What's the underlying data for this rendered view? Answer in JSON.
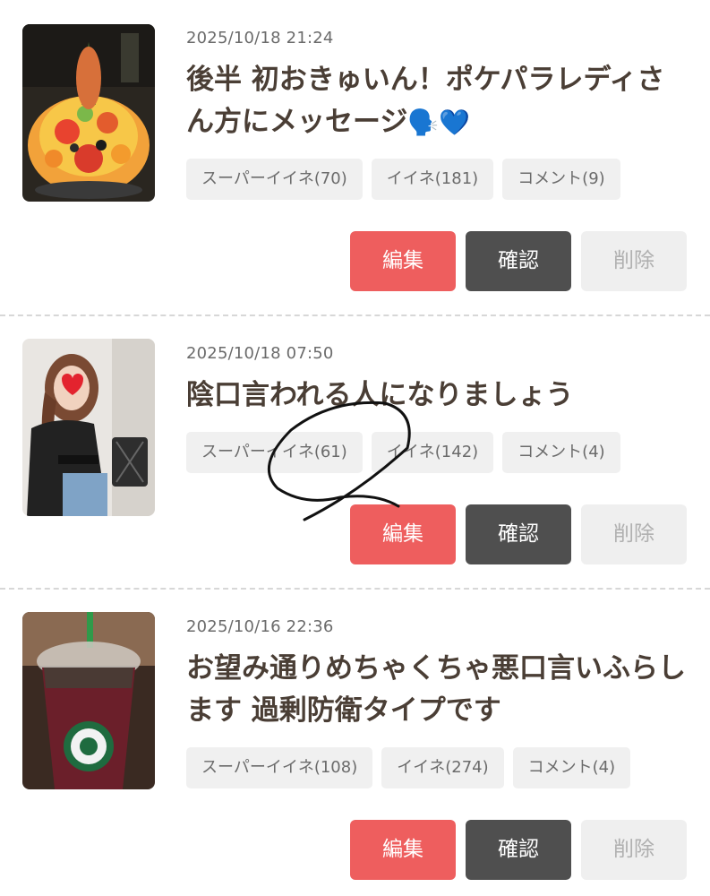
{
  "posts": [
    {
      "date": "2025/10/18 21:24",
      "title": "後半 初おきゅいん！ポケパラレディさん方にメッセージ",
      "title_emoji": "🗣️💙",
      "thumbnail_icon": "fruit-platter-photo",
      "tags": [
        "スーパーイイネ(70)",
        "イイネ(181)",
        "コメント(9)"
      ],
      "actions": {
        "edit": "編集",
        "confirm": "確認",
        "delete": "削除"
      }
    },
    {
      "date": "2025/10/18 07:50",
      "title": "陰口言われる人になりましょう",
      "title_emoji": "",
      "thumbnail_icon": "woman-selfie-photo",
      "tags": [
        "スーパーイイネ(61)",
        "イイネ(142)",
        "コメント(4)"
      ],
      "actions": {
        "edit": "編集",
        "confirm": "確認",
        "delete": "削除"
      }
    },
    {
      "date": "2025/10/16 22:36",
      "title": "お望み通りめちゃくちゃ悪口言いふらします 過剰防衛タイプです",
      "title_emoji": "",
      "thumbnail_icon": "iced-drink-cup-photo",
      "tags": [
        "スーパーイイネ(108)",
        "イイネ(274)",
        "コメント(4)"
      ],
      "actions": {
        "edit": "編集",
        "confirm": "確認",
        "delete": "削除"
      }
    }
  ],
  "colors": {
    "edit": "#ee5e5e",
    "confirm": "#4f4f4f",
    "delete_bg": "#efefef",
    "tag_bg": "#f0f0f0",
    "title": "#4a3e35"
  }
}
